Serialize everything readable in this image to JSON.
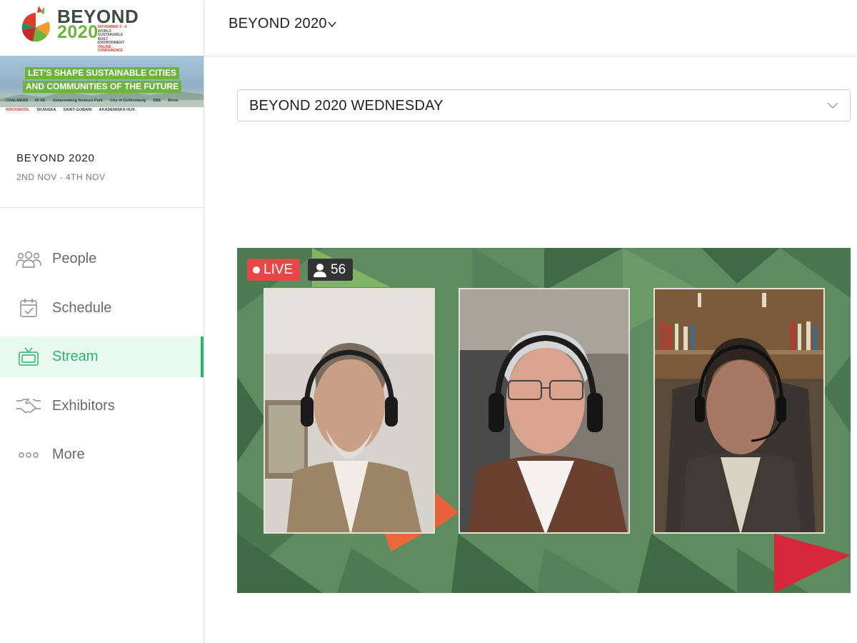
{
  "brand": {
    "word1": "BEYOND",
    "word2": "2020",
    "sub_lines": [
      "NOVEMBER 2 - 4",
      "WORLD SUSTAINABLE",
      "BUILT ENVIRONMENT",
      "ONLINE CONFERENCE"
    ],
    "accent_green": "#6cb33f"
  },
  "banner": {
    "tagline1": "LET'S SHAPE SUSTAINABLE CITIES",
    "tagline2": "AND COMMUNITIES OF THE FUTURE",
    "sponsors": [
      "CHALMERS",
      "RI SE",
      "Johanneberg Science Park",
      "City of Gothenburg",
      "SBE",
      "Bona",
      "ROCKWOOL",
      "SKANSKA",
      "SAINT-GOBAIN",
      "AKADEMISKA HUS"
    ]
  },
  "event": {
    "title": "BEYOND 2020",
    "dates": "2ND NOV - 4TH NOV"
  },
  "nav": {
    "items": [
      {
        "label": "People",
        "icon": "people-icon",
        "active": false
      },
      {
        "label": "Schedule",
        "icon": "calendar-check-icon",
        "active": false
      },
      {
        "label": "Stream",
        "icon": "tv-icon",
        "active": true
      },
      {
        "label": "Exhibitors",
        "icon": "handshake-icon",
        "active": false
      },
      {
        "label": "More",
        "icon": "more-dots-icon",
        "active": false
      }
    ],
    "active_color": "#2bb56b"
  },
  "topbar": {
    "title": "BEYOND 2020"
  },
  "session": {
    "selected": "BEYOND 2020 WEDNESDAY"
  },
  "stream": {
    "live_label": "LIVE",
    "viewer_count": "56",
    "live_color": "#e8474a"
  }
}
